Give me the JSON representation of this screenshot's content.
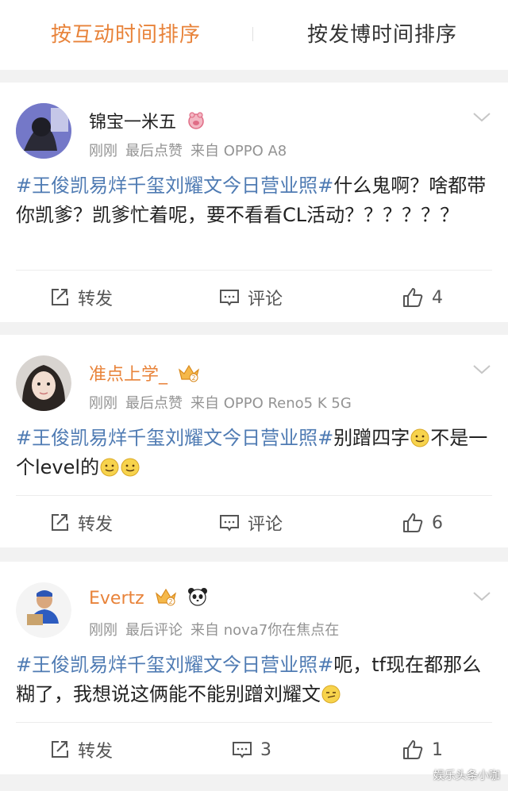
{
  "tabs": {
    "active_label": "按互动时间排序",
    "inactive_label": "按发博时间排序"
  },
  "posts": [
    {
      "username": "锦宝一米五",
      "time": "刚刚",
      "activity": "最后点赞",
      "source": "来自 OPPO A8",
      "topic": "#王俊凯易烊千玺刘耀文今日营业照#",
      "text": "什么鬼啊？啥都带你凯爹？凯爹忙着呢，要不看看CL活动？？？？？？",
      "repost_label": "转发",
      "comment_label": "评论",
      "like_count": "4"
    },
    {
      "username": "准点上学_",
      "time": "刚刚",
      "activity": "最后点赞",
      "source": "来自 OPPO Reno5 K 5G",
      "topic": "#王俊凯易烊千玺刘耀文今日营业照#",
      "text_part1": "别蹭四字",
      "text_part2": "不是一个level的",
      "repost_label": "转发",
      "comment_label": "评论",
      "like_count": "6"
    },
    {
      "username": "Evertz",
      "time": "刚刚",
      "activity": "最后评论",
      "source": "来自 nova7你在焦点在",
      "topic": "#王俊凯易烊千玺刘耀文今日营业照#",
      "text": "呃，tf现在都那么糊了，我想说这俩能不能别蹭刘耀文",
      "repost_label": "转发",
      "comment_count": "3",
      "like_count": "1"
    }
  ],
  "colors": {
    "accent": "#e8833a",
    "topic": "#4f7bb3",
    "meta": "#939393"
  },
  "watermark": "娱乐头条小咖"
}
